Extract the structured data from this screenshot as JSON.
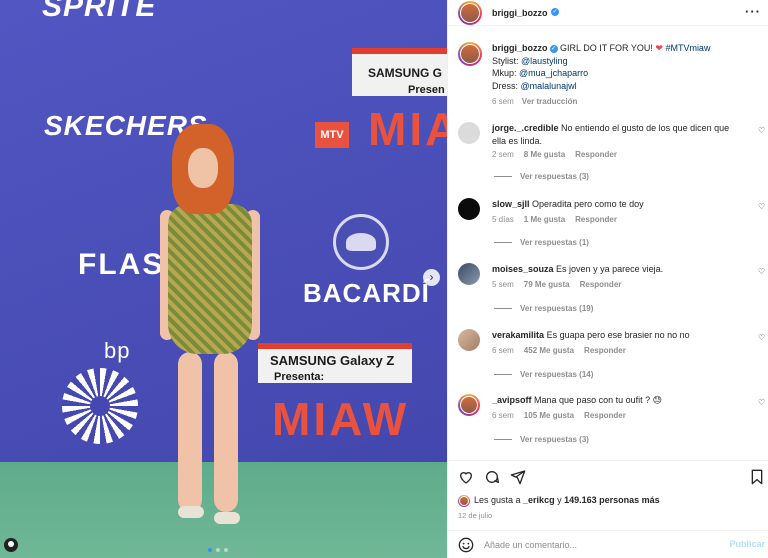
{
  "post": {
    "username": "briggi_bozzo",
    "caption": {
      "text1": "GIRL DO IT FOR YOU! ",
      "hashtag": "#MTVmiaw",
      "stylist_label": "Stylist: ",
      "stylist": "@laustyling",
      "mkup_label": "Mkup: ",
      "mkup": "@mua_jchaparro",
      "dress_label": "Dress: ",
      "dress": "@malalunajwl",
      "time": "6 sem",
      "translate": "Ver traducción"
    },
    "comments": [
      {
        "user": "jorge._.credible",
        "text": "No entiendo el gusto de los que dicen que ella es linda.",
        "time": "2 sem",
        "likes": "8 Me gusta",
        "reply": "Responder",
        "replies": "Ver respuestas (3)"
      },
      {
        "user": "slow_sjll",
        "text": "Operadita pero como te doy",
        "time": "5 días",
        "likes": "1 Me gusta",
        "reply": "Responder",
        "replies": "Ver respuestas (1)"
      },
      {
        "user": "moises_souza",
        "text": "Es joven y ya parece vieja.",
        "time": "5 sem",
        "likes": "79 Me gusta",
        "reply": "Responder",
        "replies": "Ver respuestas (19)"
      },
      {
        "user": "verakamilita",
        "text": "Es guapa pero ese brasier no no no",
        "time": "6 sem",
        "likes": "452 Me gusta",
        "reply": "Responder",
        "replies": "Ver respuestas (14)"
      },
      {
        "user": "_avipsoff",
        "text": "Mana que paso con tu oufit ? 😓",
        "time": "6 sem",
        "likes": "105 Me gusta",
        "reply": "Responder",
        "replies": "Ver respuestas (3)"
      }
    ],
    "likes_prefix": "Les gusta a ",
    "likes_user": "_erikcg",
    "likes_mid": " y ",
    "likes_count": "149.163 personas más",
    "date": "12 de julio",
    "add_comment_placeholder": "Añade un comentario...",
    "publish": "Publicar"
  },
  "photo": {
    "sprite": "SPRITE",
    "skechers": "SKECHERS",
    "flash": "FLASH",
    "bacardi": "BACARDÍ",
    "bp": "bp",
    "samsung_top": "SAMSUNG G",
    "presents_top": "Presen",
    "samsung_bottom": "SAMSUNG Galaxy Z",
    "presents_bottom": "Presenta:",
    "miaw_top": "MIA",
    "miaw_bottom": "MIAW",
    "mtv": "MTV"
  },
  "icons": {
    "more": "more-options-icon",
    "heart": "heart-icon",
    "comment": "comment-icon",
    "share": "share-icon",
    "save": "bookmark-icon",
    "emoji": "emoji-icon"
  },
  "colors": {
    "link": "#00376b",
    "verified": "#3897f0",
    "heart_emoji": "#ed4956"
  }
}
